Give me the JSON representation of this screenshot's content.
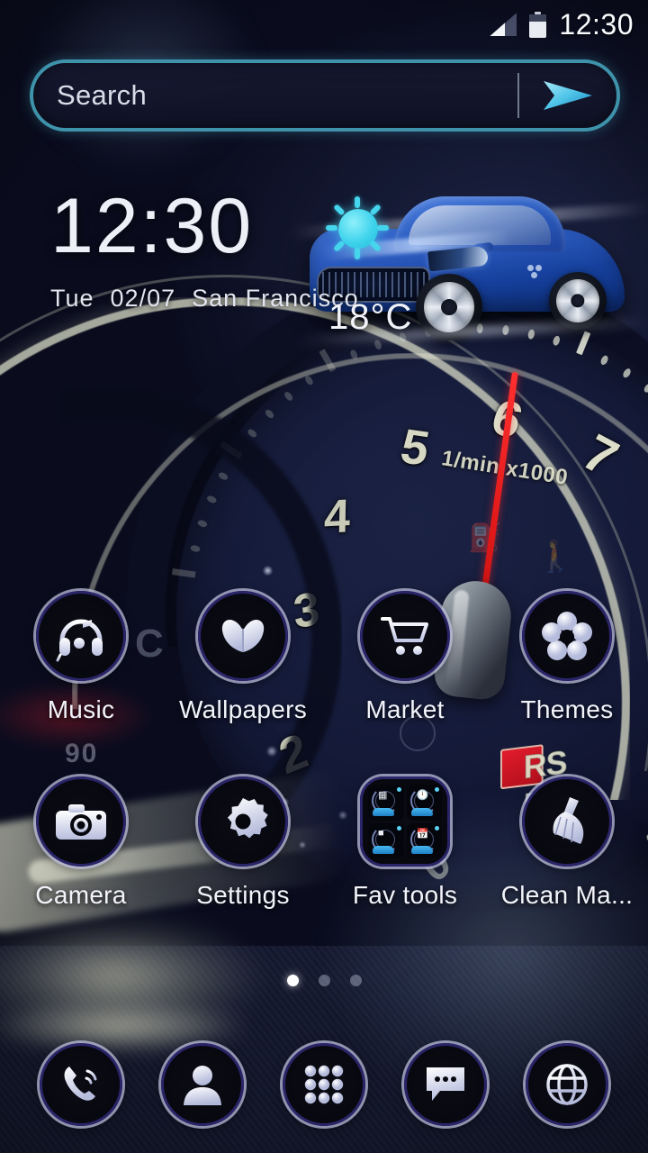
{
  "status_bar": {
    "signal_icon": "signal-bars-icon",
    "battery_icon": "battery-icon",
    "time": "12:30"
  },
  "search": {
    "placeholder": "Search",
    "send_icon": "send-arrow-icon",
    "border_color": "#3e93ab"
  },
  "clock_widget": {
    "time": "12:30",
    "weekday": "Tue",
    "date": "02/07",
    "city": "San Francisco"
  },
  "weather_widget": {
    "condition_icon": "sunny-icon",
    "temperature": "18°C",
    "accent_color": "#3fd3ec"
  },
  "wallpaper": {
    "description": "car-dashboard-tachometer",
    "tach_numbers": [
      "2",
      "3",
      "4",
      "5",
      "6",
      "7"
    ],
    "tach_unit": "1/min x1000",
    "tach_zero": "0",
    "temp_gauge_label": "90",
    "temp_gauge_unit": "C",
    "badge_letter": "R",
    "badge_text": "RS 5",
    "badge_color": "#e21b2c"
  },
  "app_grid": {
    "rows": [
      [
        {
          "label": "Music",
          "icon": "headphones-icon"
        },
        {
          "label": "Wallpapers",
          "icon": "butterfly-icon"
        },
        {
          "label": "Market",
          "icon": "shopping-cart-icon"
        },
        {
          "label": "Themes",
          "icon": "flower-icon"
        }
      ],
      [
        {
          "label": "Camera",
          "icon": "camera-icon"
        },
        {
          "label": "Settings",
          "icon": "gear-icon"
        },
        {
          "label": "Fav tools",
          "icon": "folder-icon"
        },
        {
          "label": "Clean Ma...",
          "icon": "broom-icon"
        }
      ]
    ],
    "folder_items": [
      {
        "icon": "qr-scanner-icon"
      },
      {
        "icon": "clock-icon"
      },
      {
        "icon": "battery-saver-icon"
      },
      {
        "icon": "calendar-icon"
      }
    ]
  },
  "page_indicator": {
    "total": 3,
    "active_index": 0
  },
  "dock": {
    "items": [
      {
        "name": "phone",
        "icon": "phone-icon"
      },
      {
        "name": "contacts",
        "icon": "contact-person-icon"
      },
      {
        "name": "app-drawer",
        "icon": "app-drawer-grid-icon"
      },
      {
        "name": "messages",
        "icon": "message-bubble-icon"
      },
      {
        "name": "browser",
        "icon": "globe-icon"
      }
    ]
  }
}
